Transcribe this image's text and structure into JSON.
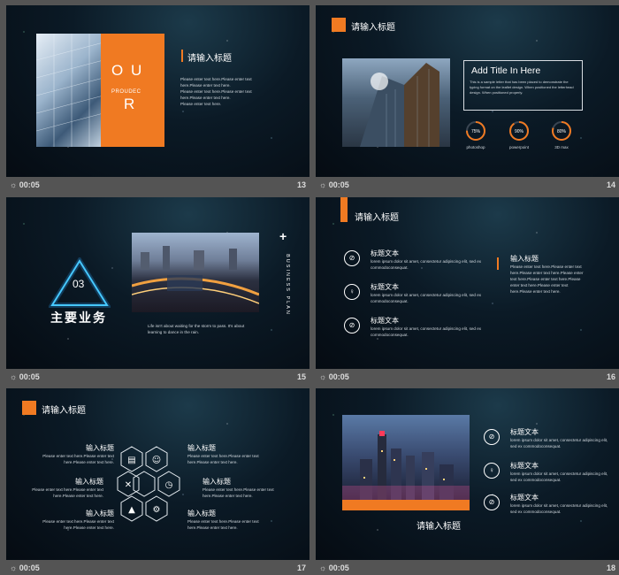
{
  "footer_time": "00:05",
  "lorem": {
    "short": "Please enter text here.Please enter text here.Please enter text here.",
    "line": "lorem ipsum dolor sit amet, consectetur adipiscing elit, sed ex commodoconsequat."
  },
  "slide13": {
    "num": "13",
    "our_letters": "O U R",
    "our_text": "O U",
    "r_text": "R",
    "proudec": "PROUDEC",
    "title": "请输入标题",
    "body": [
      "Please enter text here.Please enter text here.Please enter text here.",
      "Please enter text here.Please enter text here.Please enter text here.",
      "Please enter text here."
    ]
  },
  "slide14": {
    "num": "14",
    "title": "请输入标题",
    "box_title": "Add Title In Here",
    "box_text": "This is a sample letter that has been placed to demonstrate the typing format on the leaflet design. When positioned the letterhead design. When positioned properly.",
    "stats": [
      {
        "pct": "75%",
        "value": 0.75,
        "label": "photoshop"
      },
      {
        "pct": "90%",
        "value": 0.9,
        "label": "powerpoint"
      },
      {
        "pct": "80%",
        "value": 0.8,
        "label": "3D max"
      }
    ],
    "accent": "#f07a22"
  },
  "slide15": {
    "num": "15",
    "badge": "03",
    "title": "主要业务",
    "vertical": "BUSINESS PLAN",
    "caption": "Life isn't about waiting for the storm to pass. It's about learning to dance in the rain."
  },
  "slide16": {
    "num": "16",
    "title": "请输入标题",
    "items": [
      {
        "title": "标题文本",
        "text": "lorem ipsum dolor sit amet, consectetur adipiscing elit, sed ex commodoconsequat."
      },
      {
        "title": "标题文本",
        "text": "lorem ipsum dolor sit amet, consectetur adipiscing elit, sed ex commodoconsequat."
      },
      {
        "title": "标题文本",
        "text": "lorem ipsum dolor sit amet, consectetur adipiscing elit, sed ex commodoconsequat."
      }
    ],
    "side_title": "输入标题",
    "side_text": "Please enter text here.Please enter text here.Please enter text here.Please enter text here.Please enter text here.Please enter text here.Please enter text here.Please enter text here."
  },
  "slide17": {
    "num": "17",
    "title": "请输入标题",
    "labels": [
      {
        "title": "输入标题",
        "text": "Please enter text here.Please enter text here.Please enter text here."
      },
      {
        "title": "输入标题",
        "text": "Please enter text here.Please enter text here.Please enter text here."
      },
      {
        "title": "输入标题",
        "text": "Please enter text here.Please enter text here.Please enter text here."
      },
      {
        "title": "输入标题",
        "text": "Please enter text here.Please enter text here.Please enter text here."
      },
      {
        "title": "输入标题",
        "text": "Please enter text here.Please enter text here.Please enter text here."
      },
      {
        "title": "输入标题",
        "text": "Please enter text here.Please enter text here.Please enter text here."
      }
    ]
  },
  "slide18": {
    "num": "18",
    "title": "请输入标题",
    "items": [
      {
        "title": "标题文本",
        "text": "lorem ipsum dolor sit amet, consectetur adipiscing elit, sed ex commodoconsequat."
      },
      {
        "title": "标题文本",
        "text": "lorem ipsum dolor sit amet, consectetur adipiscing elit, sed ex commodoconsequat."
      },
      {
        "title": "标题文本",
        "text": "lorem ipsum dolor sit amet, consectetur adipiscing elit, sed ex commodoconsequat."
      }
    ]
  }
}
